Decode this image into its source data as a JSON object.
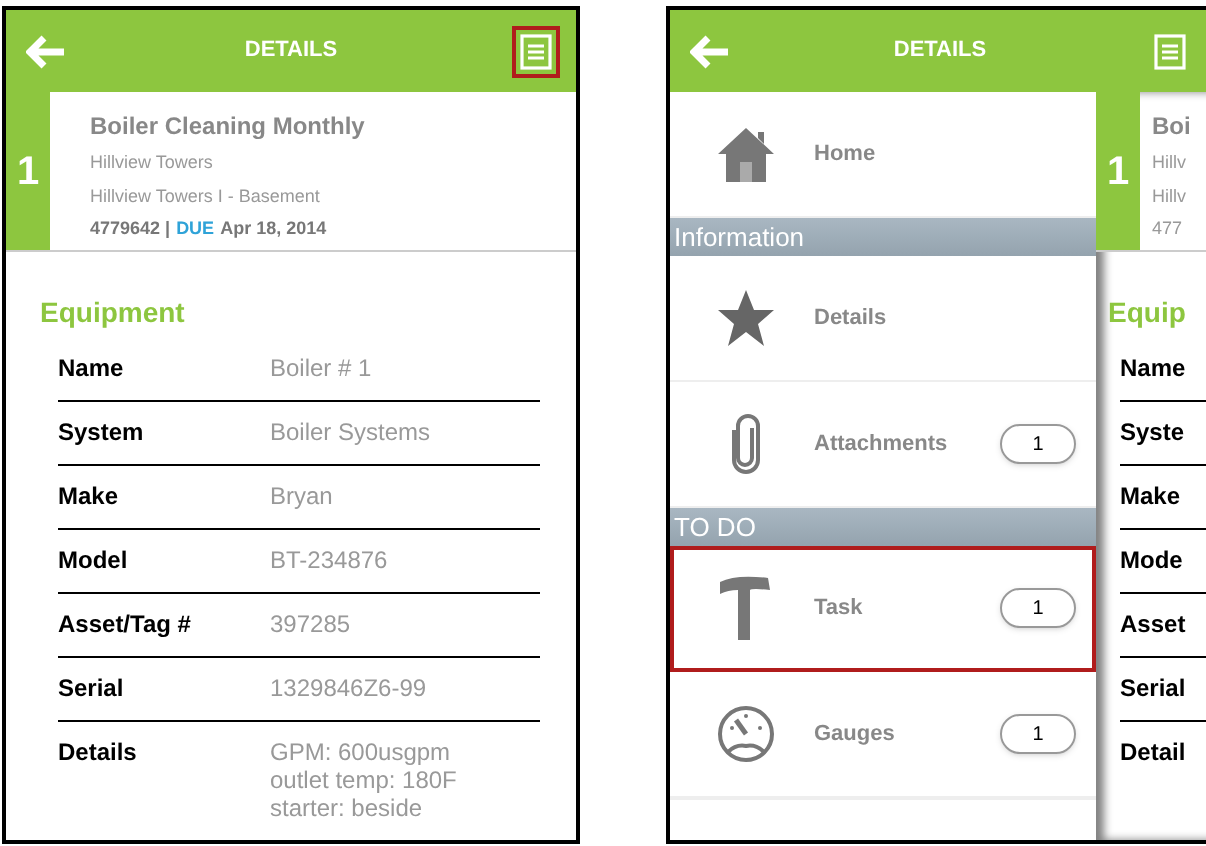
{
  "screens": [
    {
      "header": {
        "title": "DETAILS",
        "menu_highlighted": true
      },
      "work_order": {
        "number": "1",
        "title": "Boiler Cleaning Monthly",
        "site": "Hillview Towers",
        "location": "Hillview Towers I - Basement",
        "id": "4779642 |",
        "due_label": "DUE",
        "due_date": "Apr 18, 2014"
      },
      "section_title": "Equipment",
      "fields": [
        {
          "label": "Name",
          "value": "Boiler # 1"
        },
        {
          "label": "System",
          "value": "Boiler Systems"
        },
        {
          "label": "Make",
          "value": "Bryan"
        },
        {
          "label": "Model",
          "value": "BT-234876"
        },
        {
          "label": "Asset/Tag #",
          "value": "397285"
        },
        {
          "label": "Serial",
          "value": "1329846Z6-99"
        },
        {
          "label": "Details",
          "value": "GPM: 600usgpm\noutlet temp: 180F\nstarter: beside"
        }
      ]
    },
    {
      "header": {
        "title": "DETAILS",
        "menu_highlighted": false
      },
      "menu": [
        {
          "kind": "item",
          "label": "Home",
          "highlighted": false
        },
        {
          "kind": "section",
          "label": "Information"
        },
        {
          "kind": "item",
          "label": "Details",
          "highlighted": false
        },
        {
          "kind": "item",
          "label": "Attachments",
          "count": "1",
          "highlighted": false
        },
        {
          "kind": "section",
          "label": "TO DO"
        },
        {
          "kind": "item",
          "label": "Task",
          "count": "1",
          "highlighted": true
        },
        {
          "kind": "item",
          "label": "Gauges",
          "count": "1",
          "highlighted": false
        }
      ],
      "behind": {
        "number": "1",
        "lines": [
          "Boi",
          "Hillv",
          "Hillv",
          "477"
        ],
        "section_title": "Equip",
        "labels": [
          "Name",
          "Syste",
          "Make",
          "Mode",
          "Asset",
          "Serial",
          "Detail"
        ]
      }
    }
  ]
}
